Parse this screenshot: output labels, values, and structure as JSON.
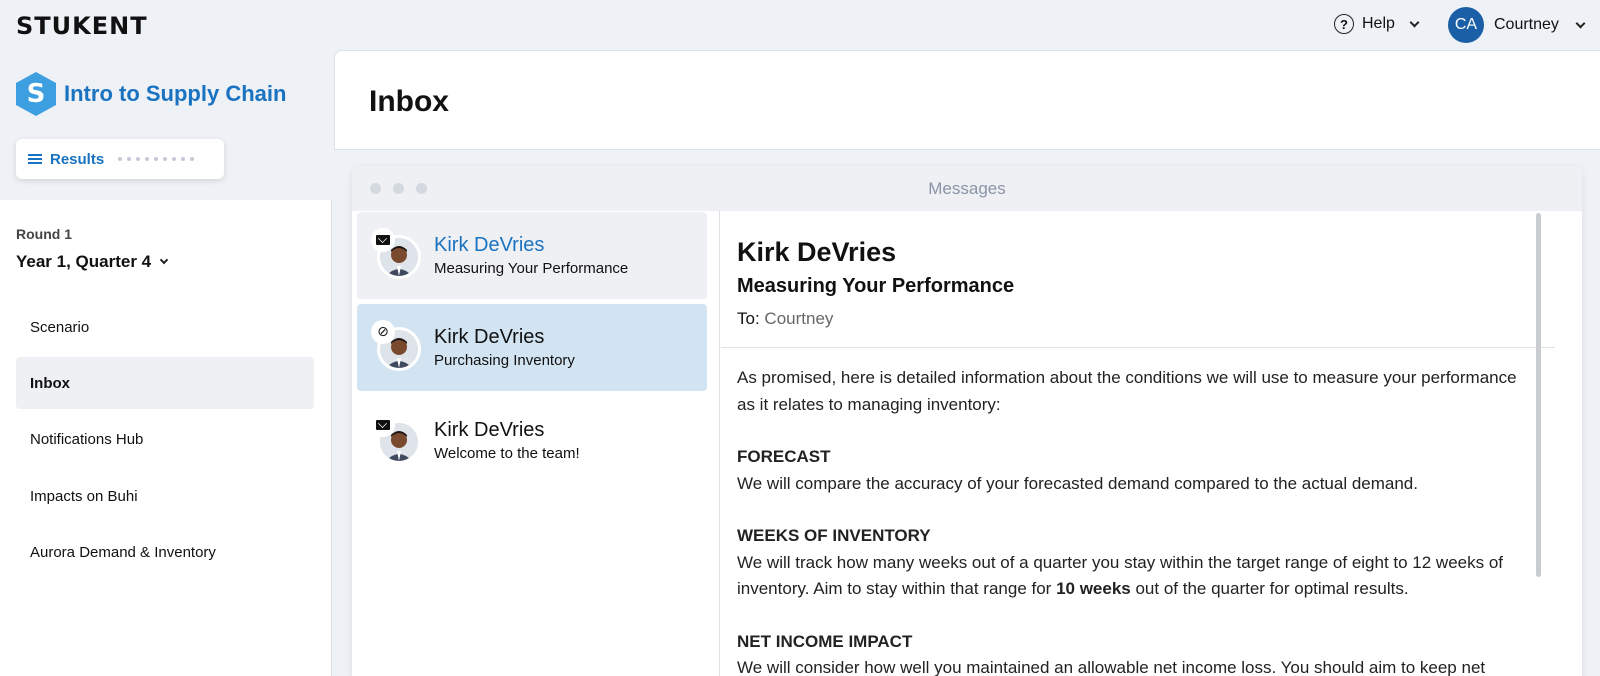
{
  "topbar": {
    "logo": "STUKENT",
    "help_label": "Help",
    "help_glyph": "?",
    "user_initials": "CA",
    "user_name": "Courtney"
  },
  "course": {
    "logo_letter": "S",
    "title": "Intro to Supply Chain",
    "results_label": "Results"
  },
  "sidebar": {
    "round": "Round 1",
    "quarter": "Year 1, Quarter 4",
    "items": [
      {
        "label": "Scenario"
      },
      {
        "label": "Inbox"
      },
      {
        "label": "Notifications Hub"
      },
      {
        "label": "Impacts on Buhi"
      },
      {
        "label": "Aurora Demand & Inventory"
      }
    ]
  },
  "main": {
    "title": "Inbox",
    "window_title": "Messages"
  },
  "messages": [
    {
      "sender": "Kirk DeVries",
      "subject": "Measuring Your Performance",
      "badge": "envelope-icon"
    },
    {
      "sender": "Kirk DeVries",
      "subject": "Purchasing Inventory",
      "badge": "paperclip-icon"
    },
    {
      "sender": "Kirk DeVries",
      "subject": "Welcome to the team!",
      "badge": "envelope-icon"
    }
  ],
  "detail": {
    "sender": "Kirk DeVries",
    "subject": "Measuring Your Performance",
    "to_label": "To:",
    "to_value": "Courtney",
    "intro": "As promised, here is detailed information about the conditions we will use to measure your performance as it relates to managing inventory:",
    "sections": [
      {
        "heading": "FORECAST",
        "text": "We will compare the accuracy of your forecasted demand compared to the actual demand."
      },
      {
        "heading": "WEEKS OF INVENTORY",
        "text_before": "We will track how many weeks out of a quarter you stay within the target range of eight to 12 weeks of inventory. Aim to stay within that range for ",
        "text_bold": "10 weeks",
        "text_after": " out of the quarter for optimal results."
      },
      {
        "heading": "NET INCOME IMPACT",
        "text": "We will consider how well you maintained an allowable net income loss. You should aim to keep net"
      }
    ]
  },
  "colors": {
    "accent": "#1a73c1",
    "selected_row": "#d2e3f2",
    "avatar_bg": "#1b5fa6"
  }
}
